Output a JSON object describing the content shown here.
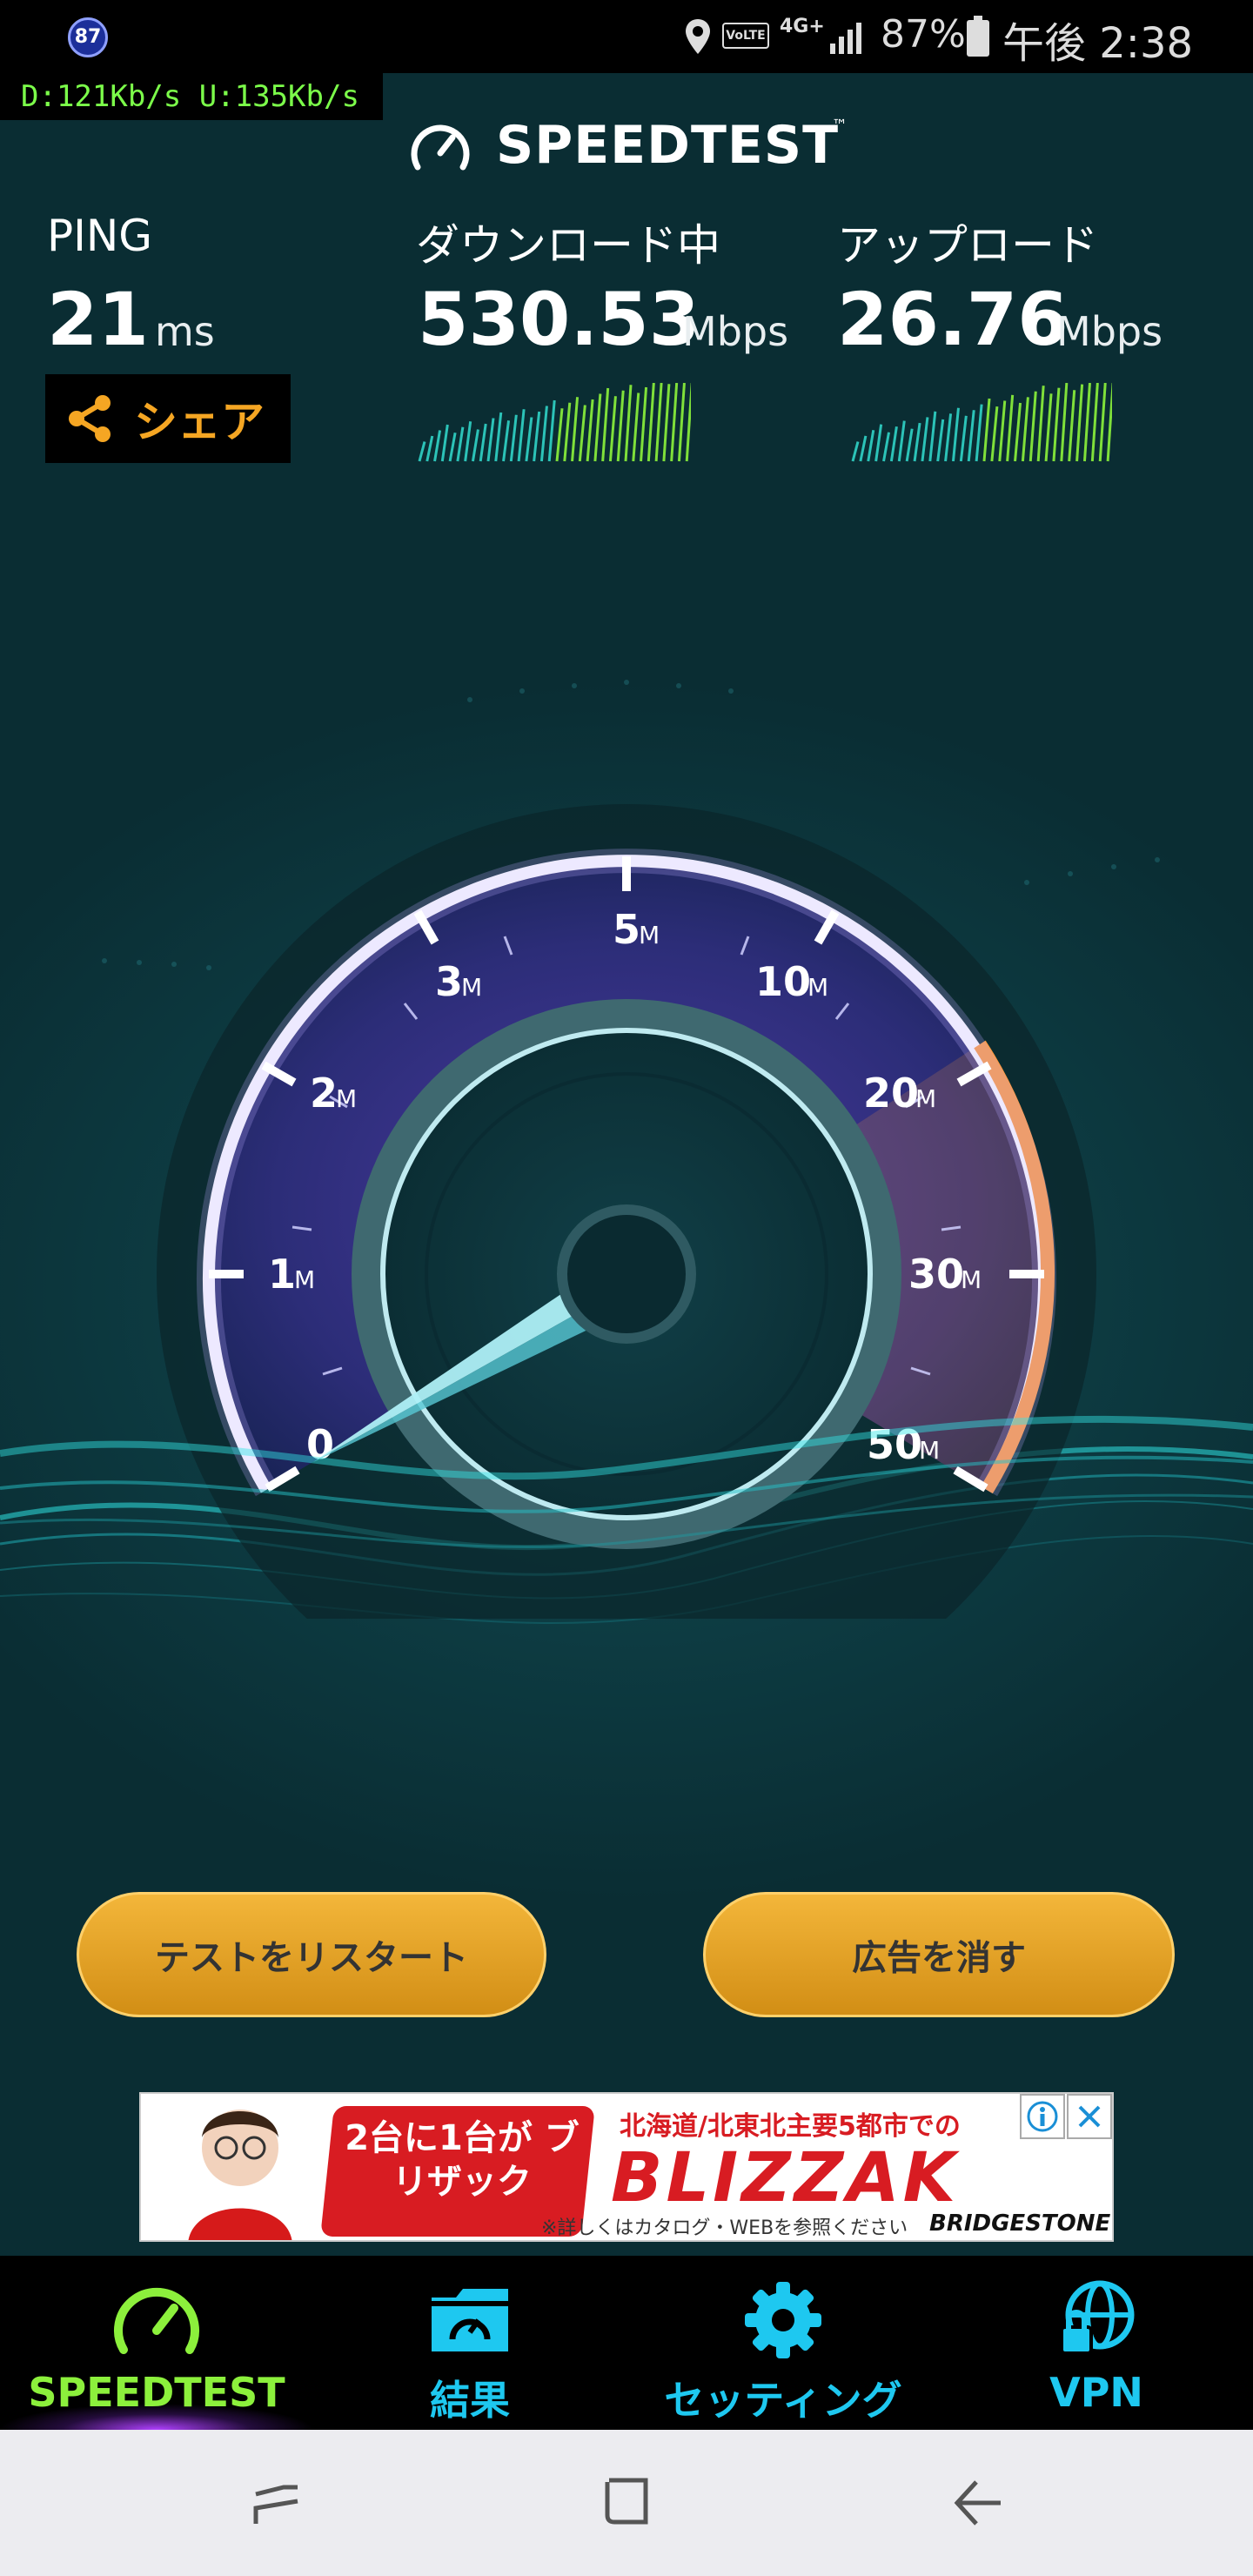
{
  "status_bar": {
    "notification_badge": "87",
    "volte": "VoLTE",
    "network": "4G+",
    "battery": "87%",
    "time": "午後 2:38"
  },
  "net_meter": "D:121Kb/s U:135Kb/s",
  "app": {
    "title": "SPEEDTEST",
    "trademark": "™"
  },
  "ping": {
    "label": "PING",
    "value": "21",
    "unit": "ms"
  },
  "share": {
    "label": "シェア"
  },
  "download": {
    "label": "ダウンロード中",
    "value": "530.53",
    "unit": "Mbps"
  },
  "upload": {
    "label": "アップロード",
    "value": "26.76",
    "unit": "Mbps"
  },
  "gauge": {
    "ticks": [
      "0",
      "1",
      "2",
      "3",
      "5",
      "10",
      "20",
      "30",
      "50"
    ],
    "unit": "M",
    "colors": {
      "ring": "#ffffff",
      "active": "#ff9a3c",
      "dial": "#3a2f80"
    }
  },
  "buttons": {
    "restart": "テストをリスタート",
    "remove_ads": "広告を消す"
  },
  "ad": {
    "headline": "北海道/北東北主要5都市での",
    "promo": "2台に1台が ブリザック",
    "brand": "BLIZZAK",
    "footer": "※詳しくはカタログ・WEBを参照ください",
    "maker": "BRIDGESTONE"
  },
  "nav": [
    {
      "label": "SPEEDTEST",
      "icon": "speedometer-icon",
      "active": true
    },
    {
      "label": "結果",
      "icon": "results-folder-icon"
    },
    {
      "label": "セッティング",
      "icon": "gear-icon"
    },
    {
      "label": "VPN",
      "icon": "vpn-globe-lock-icon"
    }
  ],
  "colors": {
    "accent": "#1ec8f0",
    "active_nav": "#8cf03c",
    "button": "#e2a028",
    "share_text": "#f5a623"
  }
}
